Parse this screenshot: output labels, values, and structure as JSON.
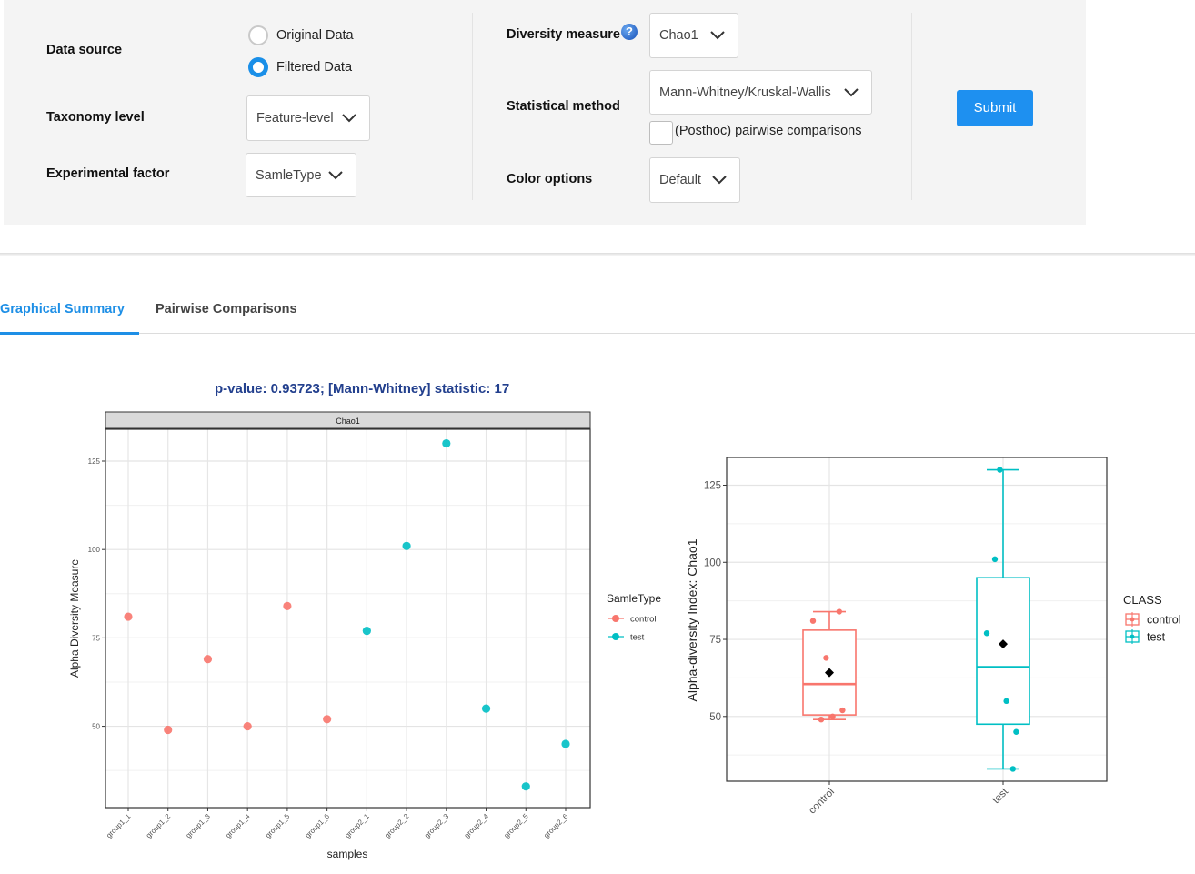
{
  "form": {
    "data_source": {
      "label": "Data source",
      "options": [
        {
          "label": "Original Data",
          "selected": false
        },
        {
          "label": "Filtered Data",
          "selected": true
        }
      ]
    },
    "taxonomy_level": {
      "label": "Taxonomy level",
      "value": "Feature-level"
    },
    "experimental_factor": {
      "label": "Experimental factor",
      "value": "SamleType"
    },
    "diversity_measure": {
      "label": "Diversity measure",
      "value": "Chao1",
      "help_icon": "question-icon"
    },
    "statistical_method": {
      "label": "Statistical method",
      "value": "Mann-Whitney/Kruskal-Wallis"
    },
    "posthoc": {
      "label": "(Posthoc) pairwise comparisons",
      "checked": false
    },
    "color_options": {
      "label": "Color options",
      "value": "Default"
    },
    "submit_label": "Submit"
  },
  "tabs": [
    {
      "label": "Graphical Summary",
      "active": true
    },
    {
      "label": "Pairwise Comparisons",
      "active": false
    }
  ],
  "stat_text": "p-value: 0.93723; [Mann-Whitney] statistic: 17",
  "colors": {
    "accent": "#1e8fe6",
    "control": "#f8766d",
    "test": "#00bfc4",
    "stat_text": "#23408e"
  },
  "chart_data": [
    {
      "type": "scatter",
      "title": "Chao1",
      "xlabel": "samples",
      "ylabel": "Alpha Diversity Measure",
      "categories": [
        "group1_1",
        "group1_2",
        "group1_3",
        "group1_4",
        "group1_5",
        "group1_6",
        "group2_1",
        "group2_2",
        "group2_3",
        "group2_4",
        "group2_5",
        "group2_6"
      ],
      "values": [
        81,
        49,
        69,
        50,
        84,
        52,
        77,
        101,
        130,
        55,
        33,
        45
      ],
      "groups": [
        "control",
        "control",
        "control",
        "control",
        "control",
        "control",
        "test",
        "test",
        "test",
        "test",
        "test",
        "test"
      ],
      "yticks": [
        50,
        75,
        100,
        125
      ],
      "ylim": [
        27,
        134
      ],
      "legend": {
        "title": "SamleType",
        "entries": [
          "control",
          "test"
        ],
        "position": "right"
      },
      "grid": true
    },
    {
      "type": "box",
      "xlabel": "",
      "ylabel": "Alpha-diversity Index: Chao1",
      "categories": [
        "control",
        "test"
      ],
      "boxes": [
        {
          "name": "control",
          "min": 49,
          "q1": 50.5,
          "median": 60.5,
          "q3": 78,
          "max": 84,
          "mean": 64.2,
          "points": [
            81,
            49,
            69,
            50,
            84,
            52
          ]
        },
        {
          "name": "test",
          "min": 33,
          "q1": 47.5,
          "median": 66,
          "q3": 95,
          "max": 130,
          "mean": 73.5,
          "points": [
            77,
            101,
            130,
            55,
            33,
            45
          ]
        }
      ],
      "yticks": [
        50,
        75,
        100,
        125
      ],
      "ylim": [
        29,
        134
      ],
      "legend": {
        "title": "CLASS",
        "entries": [
          "control",
          "test"
        ],
        "position": "right"
      },
      "grid": true
    }
  ]
}
